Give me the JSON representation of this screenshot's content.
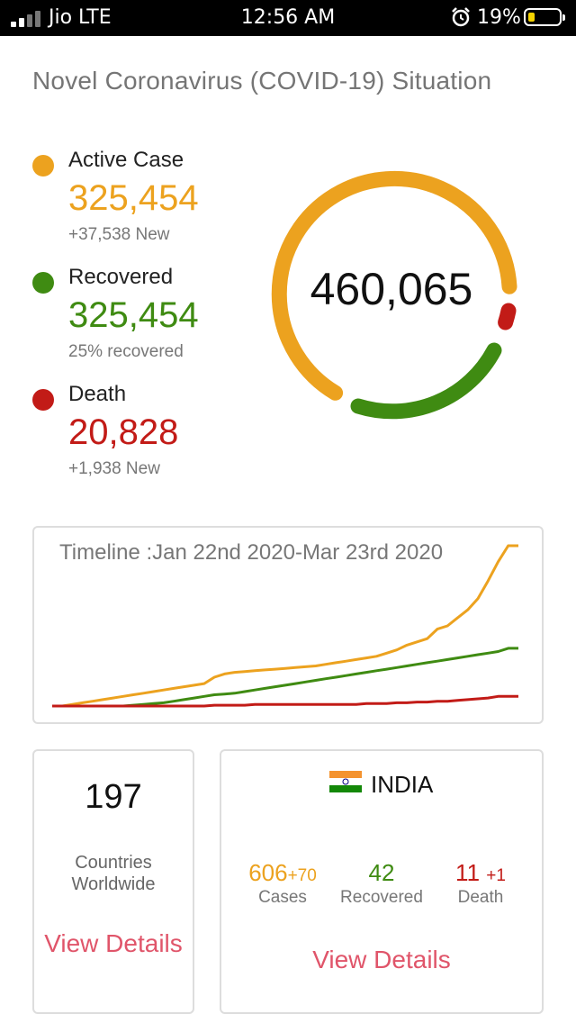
{
  "status_bar": {
    "carrier": "Jio LTE",
    "time": "12:56 AM",
    "battery": "19%"
  },
  "header": {
    "title": "Novel Coronavirus (COVID-19) Situation"
  },
  "colors": {
    "active": "#eca21f",
    "recovered": "#3f8b12",
    "death": "#c21b17",
    "link": "#e0556a"
  },
  "stats": {
    "active": {
      "label": "Active Case",
      "value": "325,454",
      "sub": "+37,538 New"
    },
    "recovered": {
      "label": "Recovered",
      "value": "325,454",
      "sub": "25% recovered"
    },
    "death": {
      "label": "Death",
      "value": "20,828",
      "sub": "+1,938 New"
    }
  },
  "donut": {
    "total": "460,065"
  },
  "timeline": {
    "title": "Timeline :Jan 22nd 2020-Mar 23rd 2020",
    "chart_data": {
      "type": "line",
      "series": [
        {
          "color": "#eca21f",
          "values": [
            0,
            0,
            0.01,
            0.02,
            0.03,
            0.04,
            0.05,
            0.06,
            0.07,
            0.08,
            0.09,
            0.1,
            0.11,
            0.12,
            0.13,
            0.14,
            0.18,
            0.2,
            0.21,
            0.215,
            0.22,
            0.225,
            0.23,
            0.235,
            0.24,
            0.245,
            0.25,
            0.26,
            0.27,
            0.28,
            0.29,
            0.3,
            0.31,
            0.33,
            0.35,
            0.38,
            0.4,
            0.42,
            0.48,
            0.5,
            0.55,
            0.6,
            0.67,
            0.78,
            0.9,
            1.0,
            1.0
          ]
        },
        {
          "color": "#3f8b12",
          "values": [
            0,
            0,
            0,
            0,
            0,
            0,
            0,
            0,
            0.005,
            0.01,
            0.015,
            0.02,
            0.03,
            0.04,
            0.05,
            0.06,
            0.07,
            0.075,
            0.08,
            0.09,
            0.1,
            0.11,
            0.12,
            0.13,
            0.14,
            0.15,
            0.16,
            0.17,
            0.18,
            0.19,
            0.2,
            0.21,
            0.22,
            0.23,
            0.24,
            0.25,
            0.26,
            0.27,
            0.28,
            0.29,
            0.3,
            0.31,
            0.32,
            0.33,
            0.34,
            0.36,
            0.36
          ]
        },
        {
          "color": "#c21b17",
          "values": [
            0,
            0,
            0,
            0,
            0,
            0,
            0,
            0,
            0,
            0,
            0,
            0,
            0,
            0,
            0,
            0,
            0.005,
            0.005,
            0.005,
            0.005,
            0.01,
            0.01,
            0.01,
            0.01,
            0.01,
            0.01,
            0.01,
            0.01,
            0.01,
            0.01,
            0.01,
            0.015,
            0.015,
            0.015,
            0.02,
            0.02,
            0.025,
            0.025,
            0.03,
            0.03,
            0.035,
            0.04,
            0.045,
            0.05,
            0.06,
            0.06,
            0.06
          ]
        }
      ]
    }
  },
  "countries": {
    "count": "197",
    "label": "Countries Worldwide",
    "view": "View Details"
  },
  "india": {
    "name": "INDIA",
    "cases": "606",
    "cases_new": "+70",
    "cases_label": "Cases",
    "recovered": "42",
    "recovered_label": "Recovered",
    "death": "11",
    "death_new": "+1",
    "death_label": "Death",
    "view": "View Details"
  }
}
